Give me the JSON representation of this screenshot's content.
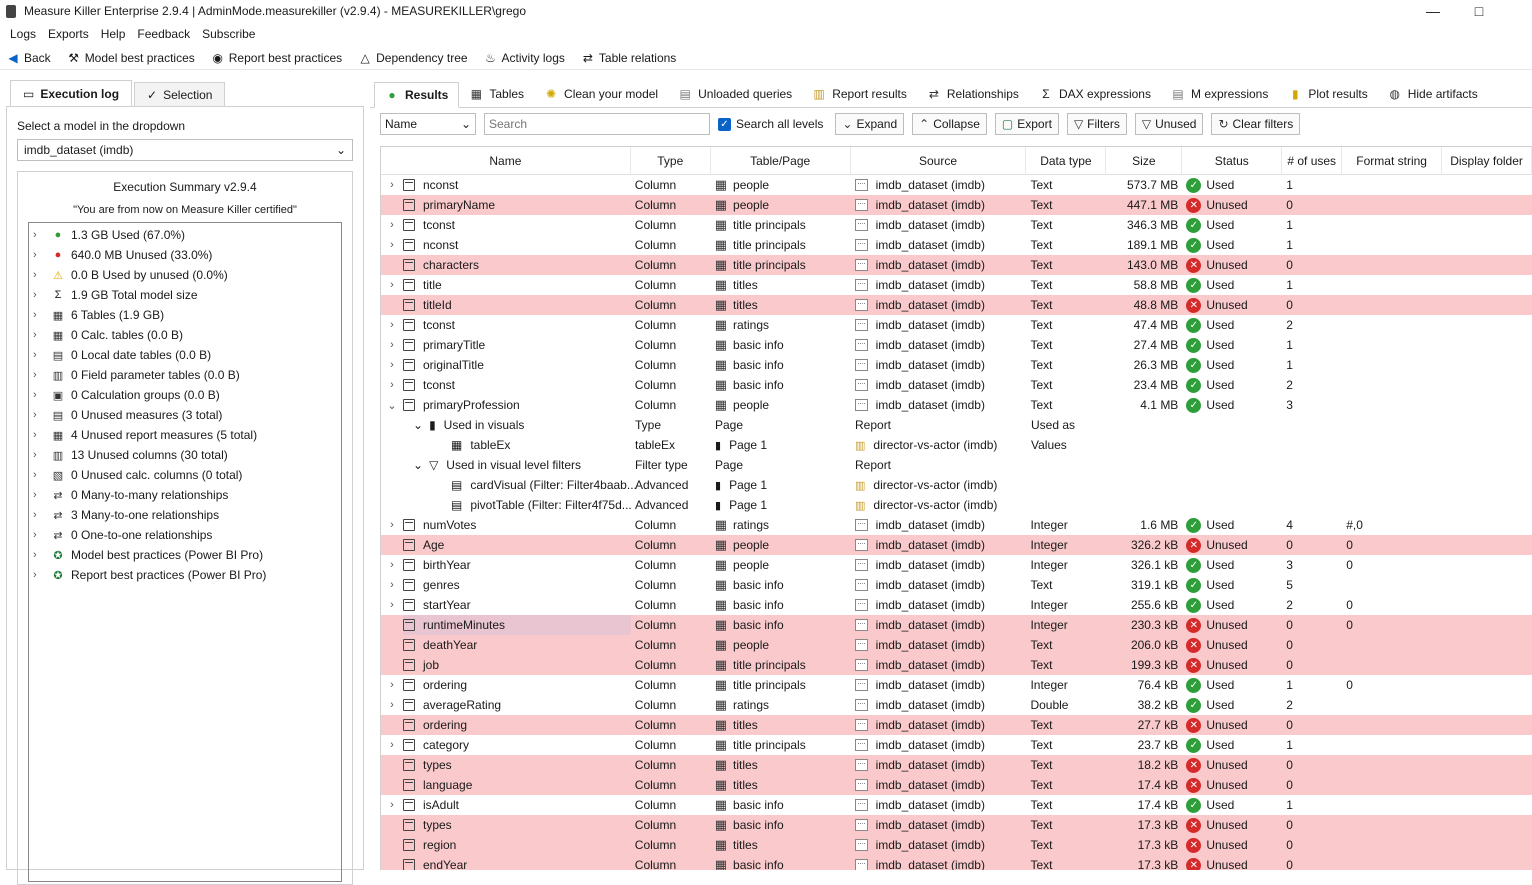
{
  "window": {
    "title": "Measure Killer Enterprise 2.9.4 | AdminMode.measurekiller (v2.9.4) - MEASUREKILLER\\grego"
  },
  "menu": [
    "Logs",
    "Exports",
    "Help",
    "Feedback",
    "Subscribe"
  ],
  "toolbar": [
    {
      "label": "Back",
      "icon": "back-arrow-icon"
    },
    {
      "label": "Model best practices",
      "icon": "hammer-icon"
    },
    {
      "label": "Report best practices",
      "icon": "ribbon-icon"
    },
    {
      "label": "Dependency tree",
      "icon": "tree-icon"
    },
    {
      "label": "Activity logs",
      "icon": "bell-icon"
    },
    {
      "label": "Table relations",
      "icon": "relations-icon"
    }
  ],
  "left": {
    "tabs": [
      "Execution log",
      "Selection"
    ],
    "select_label": "Select a model in the dropdown",
    "model_value": "imdb_dataset (imdb)",
    "summary_title": "Execution Summary v2.9.4",
    "certified": "\"You are from now on Measure Killer certified\"",
    "items": [
      {
        "label": "1.3 GB Used (67.0%)",
        "icon": "check-circle-icon"
      },
      {
        "label": "640.0 MB Unused (33.0%)",
        "icon": "x-circle-icon"
      },
      {
        "label": "0.0 B Used by unused (0.0%)",
        "icon": "warning-icon"
      },
      {
        "label": "1.9 GB Total model size",
        "icon": "sigma-icon"
      },
      {
        "label": "6 Tables (1.9 GB)",
        "icon": "table-icon"
      },
      {
        "label": "0 Calc. tables (0.0 B)",
        "icon": "calc-table-icon"
      },
      {
        "label": "0 Local date tables (0.0 B)",
        "icon": "date-table-icon"
      },
      {
        "label": "0 Field parameter tables (0.0 B)",
        "icon": "param-table-icon"
      },
      {
        "label": "0 Calculation groups (0.0 B)",
        "icon": "calc-group-icon"
      },
      {
        "label": "0 Unused measures (3 total)",
        "icon": "measure-icon"
      },
      {
        "label": "4 Unused report measures (5 total)",
        "icon": "report-measure-icon"
      },
      {
        "label": "13 Unused columns (30 total)",
        "icon": "column-icon"
      },
      {
        "label": "0 Unused calc. columns (0 total)",
        "icon": "calc-column-icon"
      },
      {
        "label": "0 Many-to-many relationships",
        "icon": "relation-icon"
      },
      {
        "label": "3 Many-to-one relationships",
        "icon": "relation-icon"
      },
      {
        "label": "0 One-to-one relationships",
        "icon": "relation-icon"
      },
      {
        "label": "Model best practices (Power BI Pro)",
        "icon": "award-icon"
      },
      {
        "label": "Report best practices (Power BI Pro)",
        "icon": "award-icon"
      }
    ]
  },
  "tabs": [
    {
      "label": "Results",
      "icon": "check-circle-icon"
    },
    {
      "label": "Tables",
      "icon": "table-icon"
    },
    {
      "label": "Clean your model",
      "icon": "bulb-icon"
    },
    {
      "label": "Unloaded queries",
      "icon": "query-icon"
    },
    {
      "label": "Report results",
      "icon": "report-icon"
    },
    {
      "label": "Relationships",
      "icon": "relation-icon"
    },
    {
      "label": "DAX expressions",
      "icon": "sigma-icon"
    },
    {
      "label": "M expressions",
      "icon": "m-icon"
    },
    {
      "label": "Plot results",
      "icon": "plot-icon"
    },
    {
      "label": "Hide artifacts",
      "icon": "eye-off-icon"
    }
  ],
  "filter": {
    "field": "Name",
    "search_placeholder": "Search",
    "search_all": "Search all levels",
    "buttons": [
      {
        "label": "Expand",
        "icon": "expand-icon"
      },
      {
        "label": "Collapse",
        "icon": "collapse-icon"
      },
      {
        "label": "Export",
        "icon": "export-icon"
      },
      {
        "label": "Filters",
        "icon": "filter-icon"
      },
      {
        "label": "Unused",
        "icon": "filter-icon"
      },
      {
        "label": "Clear filters",
        "icon": "refresh-icon"
      }
    ]
  },
  "columns": [
    "Name",
    "Type",
    "Table/Page",
    "Source",
    "Data type",
    "Size",
    "Status",
    "# of uses",
    "Format string",
    "Display folder"
  ],
  "rows": [
    {
      "name": "nconst",
      "type": "Column",
      "table": "people",
      "source": "imdb_dataset (imdb)",
      "dt": "Text",
      "size": "573.7 MB",
      "status": "Used",
      "uses": "1",
      "fmt": "",
      "exp": true
    },
    {
      "name": "primaryName",
      "type": "Column",
      "table": "people",
      "source": "imdb_dataset (imdb)",
      "dt": "Text",
      "size": "447.1 MB",
      "status": "Unused",
      "uses": "0",
      "fmt": "",
      "exp": false
    },
    {
      "name": "tconst",
      "type": "Column",
      "table": "title principals",
      "source": "imdb_dataset (imdb)",
      "dt": "Text",
      "size": "346.3 MB",
      "status": "Used",
      "uses": "1",
      "fmt": "",
      "exp": true
    },
    {
      "name": "nconst",
      "type": "Column",
      "table": "title principals",
      "source": "imdb_dataset (imdb)",
      "dt": "Text",
      "size": "189.1 MB",
      "status": "Used",
      "uses": "1",
      "fmt": "",
      "exp": true
    },
    {
      "name": "characters",
      "type": "Column",
      "table": "title principals",
      "source": "imdb_dataset (imdb)",
      "dt": "Text",
      "size": "143.0 MB",
      "status": "Unused",
      "uses": "0",
      "fmt": "",
      "exp": false
    },
    {
      "name": "title",
      "type": "Column",
      "table": "titles",
      "source": "imdb_dataset (imdb)",
      "dt": "Text",
      "size": "58.8 MB",
      "status": "Used",
      "uses": "1",
      "fmt": "",
      "exp": true
    },
    {
      "name": "titleId",
      "type": "Column",
      "table": "titles",
      "source": "imdb_dataset (imdb)",
      "dt": "Text",
      "size": "48.8 MB",
      "status": "Unused",
      "uses": "0",
      "fmt": "",
      "exp": false
    },
    {
      "name": "tconst",
      "type": "Column",
      "table": "ratings",
      "source": "imdb_dataset (imdb)",
      "dt": "Text",
      "size": "47.4 MB",
      "status": "Used",
      "uses": "2",
      "fmt": "",
      "exp": true
    },
    {
      "name": "primaryTitle",
      "type": "Column",
      "table": "basic info",
      "source": "imdb_dataset (imdb)",
      "dt": "Text",
      "size": "27.4 MB",
      "status": "Used",
      "uses": "1",
      "fmt": "",
      "exp": true
    },
    {
      "name": "originalTitle",
      "type": "Column",
      "table": "basic info",
      "source": "imdb_dataset (imdb)",
      "dt": "Text",
      "size": "26.3 MB",
      "status": "Used",
      "uses": "1",
      "fmt": "",
      "exp": true
    },
    {
      "name": "tconst",
      "type": "Column",
      "table": "basic info",
      "source": "imdb_dataset (imdb)",
      "dt": "Text",
      "size": "23.4 MB",
      "status": "Used",
      "uses": "2",
      "fmt": "",
      "exp": true
    },
    {
      "name": "primaryProfession",
      "type": "Column",
      "table": "people",
      "source": "imdb_dataset (imdb)",
      "dt": "Text",
      "size": "4.1 MB",
      "status": "Used",
      "uses": "3",
      "fmt": "",
      "exp": true,
      "expanded": true
    }
  ],
  "expansion": {
    "visuals_header": {
      "label": "Used in visuals",
      "type": "Type",
      "page": "Page",
      "report": "Report",
      "used_as": "Used as"
    },
    "visual": {
      "name": "tableEx",
      "type": "tableEx",
      "page": "Page 1",
      "report": "director-vs-actor (imdb)",
      "used_as": "Values"
    },
    "filters_header": {
      "label": "Used in visual level filters",
      "type": "Filter type",
      "page": "Page",
      "report": "Report"
    },
    "filters": [
      {
        "name": "cardVisual (Filter: Filter4baab...",
        "type": "Advanced",
        "page": "Page 1",
        "report": "director-vs-actor (imdb)"
      },
      {
        "name": "pivotTable (Filter: Filter4f75d...",
        "type": "Advanced",
        "page": "Page 1",
        "report": "director-vs-actor (imdb)"
      }
    ]
  },
  "rows2": [
    {
      "name": "numVotes",
      "type": "Column",
      "table": "ratings",
      "source": "imdb_dataset (imdb)",
      "dt": "Integer",
      "size": "1.6 MB",
      "status": "Used",
      "uses": "4",
      "fmt": "#,0",
      "exp": true
    },
    {
      "name": "Age",
      "type": "Column",
      "table": "people",
      "source": "imdb_dataset (imdb)",
      "dt": "Integer",
      "size": "326.2 kB",
      "status": "Unused",
      "uses": "0",
      "fmt": "0",
      "exp": false
    },
    {
      "name": "birthYear",
      "type": "Column",
      "table": "people",
      "source": "imdb_dataset (imdb)",
      "dt": "Integer",
      "size": "326.1 kB",
      "status": "Used",
      "uses": "3",
      "fmt": "0",
      "exp": true
    },
    {
      "name": "genres",
      "type": "Column",
      "table": "basic info",
      "source": "imdb_dataset (imdb)",
      "dt": "Text",
      "size": "319.1 kB",
      "status": "Used",
      "uses": "5",
      "fmt": "",
      "exp": true
    },
    {
      "name": "startYear",
      "type": "Column",
      "table": "basic info",
      "source": "imdb_dataset (imdb)",
      "dt": "Integer",
      "size": "255.6 kB",
      "status": "Used",
      "uses": "2",
      "fmt": "0",
      "exp": true
    },
    {
      "name": "runtimeMinutes",
      "type": "Column",
      "table": "basic info",
      "source": "imdb_dataset (imdb)",
      "dt": "Integer",
      "size": "230.3 kB",
      "status": "Unused",
      "uses": "0",
      "fmt": "0",
      "exp": false,
      "hl": true
    },
    {
      "name": "deathYear",
      "type": "Column",
      "table": "people",
      "source": "imdb_dataset (imdb)",
      "dt": "Text",
      "size": "206.0 kB",
      "status": "Unused",
      "uses": "0",
      "fmt": "",
      "exp": false
    },
    {
      "name": "job",
      "type": "Column",
      "table": "title principals",
      "source": "imdb_dataset (imdb)",
      "dt": "Text",
      "size": "199.3 kB",
      "status": "Unused",
      "uses": "0",
      "fmt": "",
      "exp": false
    },
    {
      "name": "ordering",
      "type": "Column",
      "table": "title principals",
      "source": "imdb_dataset (imdb)",
      "dt": "Integer",
      "size": "76.4 kB",
      "status": "Used",
      "uses": "1",
      "fmt": "0",
      "exp": true
    },
    {
      "name": "averageRating",
      "type": "Column",
      "table": "ratings",
      "source": "imdb_dataset (imdb)",
      "dt": "Double",
      "size": "38.2 kB",
      "status": "Used",
      "uses": "2",
      "fmt": "",
      "exp": true
    },
    {
      "name": "ordering",
      "type": "Column",
      "table": "titles",
      "source": "imdb_dataset (imdb)",
      "dt": "Text",
      "size": "27.7 kB",
      "status": "Unused",
      "uses": "0",
      "fmt": "",
      "exp": false
    },
    {
      "name": "category",
      "type": "Column",
      "table": "title principals",
      "source": "imdb_dataset (imdb)",
      "dt": "Text",
      "size": "23.7 kB",
      "status": "Used",
      "uses": "1",
      "fmt": "",
      "exp": true
    },
    {
      "name": "types",
      "type": "Column",
      "table": "titles",
      "source": "imdb_dataset (imdb)",
      "dt": "Text",
      "size": "18.2 kB",
      "status": "Unused",
      "uses": "0",
      "fmt": "",
      "exp": false
    },
    {
      "name": "language",
      "type": "Column",
      "table": "titles",
      "source": "imdb_dataset (imdb)",
      "dt": "Text",
      "size": "17.4 kB",
      "status": "Unused",
      "uses": "0",
      "fmt": "",
      "exp": false
    },
    {
      "name": "isAdult",
      "type": "Column",
      "table": "basic info",
      "source": "imdb_dataset (imdb)",
      "dt": "Text",
      "size": "17.4 kB",
      "status": "Used",
      "uses": "1",
      "fmt": "",
      "exp": true
    },
    {
      "name": "types",
      "type": "Column",
      "table": "basic info",
      "source": "imdb_dataset (imdb)",
      "dt": "Text",
      "size": "17.3 kB",
      "status": "Unused",
      "uses": "0",
      "fmt": "",
      "exp": false
    },
    {
      "name": "region",
      "type": "Column",
      "table": "titles",
      "source": "imdb_dataset (imdb)",
      "dt": "Text",
      "size": "17.3 kB",
      "status": "Unused",
      "uses": "0",
      "fmt": "",
      "exp": false
    },
    {
      "name": "endYear",
      "type": "Column",
      "table": "basic info",
      "source": "imdb_dataset (imdb)",
      "dt": "Text",
      "size": "17.3 kB",
      "status": "Unused",
      "uses": "0",
      "fmt": "",
      "exp": false
    }
  ],
  "colors": {
    "unused_row": "#f9c9cb",
    "used_icon": "#2e9e3a",
    "unused_icon": "#d42a2a",
    "accent": "#0a64c8"
  }
}
